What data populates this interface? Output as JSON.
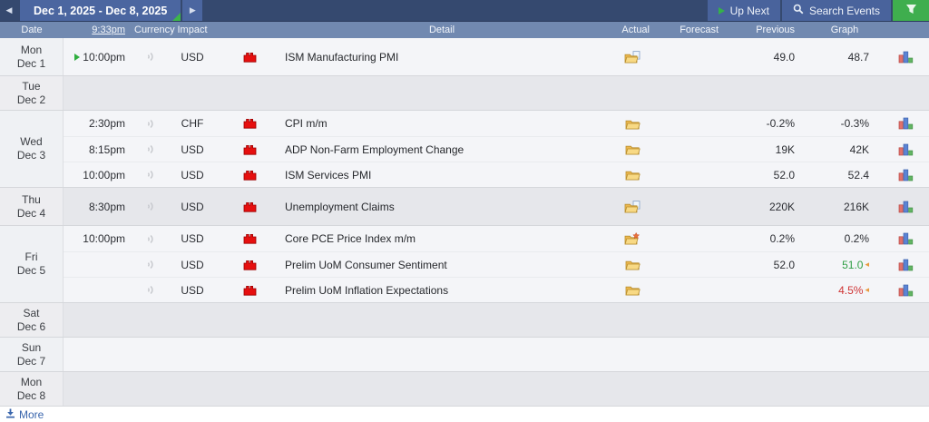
{
  "topbar": {
    "prev_arrow": "◀",
    "date_range": "Dec 1, 2025 - Dec 8, 2025",
    "next_arrow": "▶",
    "up_next_label": "Up Next",
    "search_label": "Search Events"
  },
  "header": {
    "date": "Date",
    "time": "9:33pm",
    "currency": "Currency",
    "impact": "Impact",
    "detail": "Detail",
    "actual": "Actual",
    "forecast": "Forecast",
    "previous": "Previous",
    "graph": "Graph"
  },
  "footer": {
    "more": "More"
  },
  "colors": {
    "topbar_navy": "#35496f",
    "tab_blue": "#4b66a0",
    "header_slate": "#7189b0",
    "filter_green": "#3fae4e",
    "tab_corner_green": "#3db54a",
    "impact_high_red": "#e60f0f",
    "revised_better_green": "#2f9e44",
    "revised_worse_red": "#cf3434",
    "revision_marker_orange": "#e79b3f",
    "more_link_blue": "#3a66ad"
  },
  "days": [
    {
      "day": "Mon",
      "date": "Dec 1",
      "shade": "light",
      "events": [
        {
          "time": "10:00pm",
          "up_next": true,
          "currency": "USD",
          "impact": "high",
          "title": "ISM Manufacturing PMI",
          "detail_icon": "folder-paper",
          "actual": "",
          "forecast": "49.0",
          "previous": "48.7",
          "previous_state": "",
          "revised": false
        }
      ]
    },
    {
      "day": "Tue",
      "date": "Dec 2",
      "shade": "dark",
      "events": []
    },
    {
      "day": "Wed",
      "date": "Dec 3",
      "shade": "light",
      "events": [
        {
          "time": "2:30pm",
          "up_next": false,
          "currency": "CHF",
          "impact": "high",
          "title": "CPI m/m",
          "detail_icon": "folder",
          "actual": "",
          "forecast": "-0.2%",
          "previous": "-0.3%",
          "previous_state": "",
          "revised": false
        },
        {
          "time": "8:15pm",
          "up_next": false,
          "currency": "USD",
          "impact": "high",
          "title": "ADP Non-Farm Employment Change",
          "detail_icon": "folder",
          "actual": "",
          "forecast": "19K",
          "previous": "42K",
          "previous_state": "",
          "revised": false
        },
        {
          "time": "10:00pm",
          "up_next": false,
          "currency": "USD",
          "impact": "high",
          "title": "ISM Services PMI",
          "detail_icon": "folder",
          "actual": "",
          "forecast": "52.0",
          "previous": "52.4",
          "previous_state": "",
          "revised": false
        }
      ]
    },
    {
      "day": "Thu",
      "date": "Dec 4",
      "shade": "dark",
      "events": [
        {
          "time": "8:30pm",
          "up_next": false,
          "currency": "USD",
          "impact": "high",
          "title": "Unemployment Claims",
          "detail_icon": "folder-paper",
          "actual": "",
          "forecast": "220K",
          "previous": "216K",
          "previous_state": "",
          "revised": false
        }
      ]
    },
    {
      "day": "Fri",
      "date": "Dec 5",
      "shade": "light",
      "events": [
        {
          "time": "10:00pm",
          "up_next": false,
          "currency": "USD",
          "impact": "high",
          "title": "Core PCE Price Index m/m",
          "detail_icon": "folder-star",
          "actual": "",
          "forecast": "0.2%",
          "previous": "0.2%",
          "previous_state": "",
          "revised": false
        },
        {
          "time": "",
          "up_next": false,
          "currency": "USD",
          "impact": "high",
          "title": "Prelim UoM Consumer Sentiment",
          "detail_icon": "folder",
          "actual": "",
          "forecast": "52.0",
          "previous": "51.0",
          "previous_state": "better",
          "revised": true
        },
        {
          "time": "",
          "up_next": false,
          "currency": "USD",
          "impact": "high",
          "title": "Prelim UoM Inflation Expectations",
          "detail_icon": "folder",
          "actual": "",
          "forecast": "",
          "previous": "4.5%",
          "previous_state": "worse",
          "revised": true
        }
      ]
    },
    {
      "day": "Sat",
      "date": "Dec 6",
      "shade": "dark",
      "events": []
    },
    {
      "day": "Sun",
      "date": "Dec 7",
      "shade": "light",
      "events": []
    },
    {
      "day": "Mon",
      "date": "Dec 8",
      "shade": "dark",
      "events": []
    }
  ]
}
